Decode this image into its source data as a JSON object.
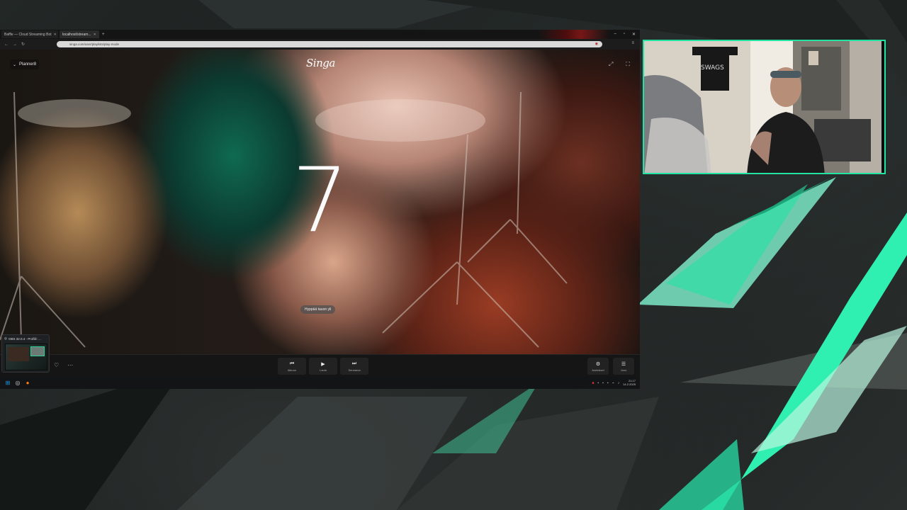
{
  "browser": {
    "tabs": [
      {
        "label": "Baffle — Cloud Streaming Bot",
        "active": false
      },
      {
        "label": "localhost/stream...",
        "active": true
      }
    ],
    "url": "singa.com/user/playlists/play-mode",
    "icons": {
      "back": "back-arrow-icon",
      "forward": "forward-arrow-icon",
      "reload": "reload-icon"
    }
  },
  "player": {
    "brand": "Singa",
    "playlist_label": "Planner8",
    "countdown": "7",
    "skip_label": "Hyppää tauon yli",
    "controls": {
      "prev_label": "Alkuun",
      "play_label": "Laula",
      "next_label": "Seuraava",
      "settings_label": "Asetukset",
      "queue_label": "Jono"
    }
  },
  "taskbar": {
    "obs_title": "OBS 32.0.4 - Profiili: ...",
    "clock_time": "21:17",
    "clock_date": "14.2.2025"
  },
  "colors": {
    "accent": "#23e3a3",
    "background": "#1b1f1e"
  }
}
